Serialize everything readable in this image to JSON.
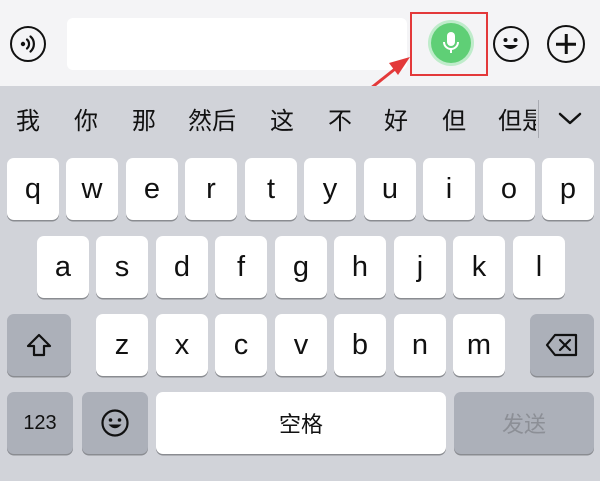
{
  "input_bar": {
    "text_value": "",
    "icons": {
      "voice_toggle": "sound-wave-icon",
      "mic": "microphone-icon",
      "emoji": "emoji-face-icon",
      "more": "plus-icon"
    },
    "mic_color": "#5fcf76",
    "highlight_color": "#e3393a"
  },
  "candidates": {
    "items": [
      "我",
      "你",
      "那",
      "然后",
      "这",
      "不",
      "好",
      "但",
      "但是"
    ],
    "expand_icon": "chevron-down-icon"
  },
  "keyboard": {
    "row1": [
      "q",
      "w",
      "e",
      "r",
      "t",
      "y",
      "u",
      "i",
      "o",
      "p"
    ],
    "row2": [
      "a",
      "s",
      "d",
      "f",
      "g",
      "h",
      "j",
      "k",
      "l"
    ],
    "row3": [
      "z",
      "x",
      "c",
      "v",
      "b",
      "n",
      "m"
    ],
    "shift_icon": "shift-arrow-icon",
    "backspace_icon": "backspace-icon",
    "numbers_label": "123",
    "emoji_key_icon": "emoji-face-icon",
    "space_label": "空格",
    "send_label": "发送"
  }
}
